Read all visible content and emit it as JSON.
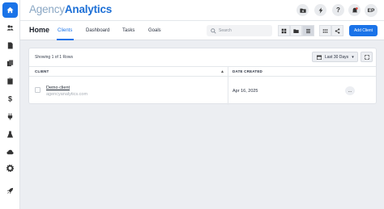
{
  "app": {
    "logo_part1": "Agency",
    "logo_part2": "Analytics",
    "accent_color": "#1a73e8"
  },
  "rail": {
    "items": [
      "home-icon",
      "users-icon",
      "file-icon",
      "reports-icon",
      "clipboard-icon",
      "dollar-icon",
      "plug-icon",
      "flask-icon",
      "cloud-icon",
      "gear-icon",
      "rocket-icon"
    ]
  },
  "header_icons": {
    "folder": "folder-add-icon",
    "bolt": "bolt-icon",
    "help_label": "?",
    "notifications": "bell-icon",
    "avatar_initials": "EP"
  },
  "nav": {
    "title": "Home",
    "tabs": [
      {
        "label": "Clients",
        "active": true
      },
      {
        "label": "Dashboard",
        "active": false
      },
      {
        "label": "Tasks",
        "active": false
      },
      {
        "label": "Goals",
        "active": false
      }
    ],
    "search_placeholder": "Search",
    "add_button": "Add Client"
  },
  "table": {
    "showing": "Showing 1 of 1 Rows",
    "date_filter": "Last 30 Days",
    "columns": [
      "CLIENT",
      "DATE CREATED"
    ],
    "rows": [
      {
        "name": "Demo client",
        "domain": "agencyanalytics.com",
        "date_created": "Apr 16, 2025",
        "more": "..."
      }
    ]
  }
}
